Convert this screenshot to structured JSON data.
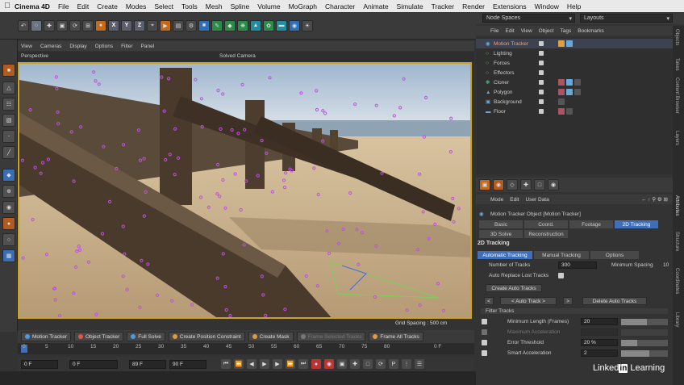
{
  "menubar": {
    "app": "Cinema 4D",
    "items": [
      "File",
      "Edit",
      "Create",
      "Modes",
      "Select",
      "Tools",
      "Mesh",
      "Spline",
      "Volume",
      "MoGraph",
      "Character",
      "Animate",
      "Simulate",
      "Tracker",
      "Render",
      "Extensions",
      "Window",
      "Help"
    ]
  },
  "toolbar": {
    "x_label": "X",
    "y_label": "Y",
    "z_label": "Z"
  },
  "viewport": {
    "menu": [
      "View",
      "Cameras",
      "Display",
      "Options",
      "Filter",
      "Panel"
    ],
    "mode": "Perspective",
    "camera": "Solved Camera",
    "grid_spacing": "Grid Spacing : 500 cm"
  },
  "tracker_bar": {
    "items": [
      {
        "label": "Motion Tracker",
        "color": "#4a9be0"
      },
      {
        "label": "Object Tracker",
        "color": "#e0573c"
      },
      {
        "label": "Full Solve",
        "color": "#4a9be0"
      },
      {
        "label": "Create Position Constraint",
        "color": "#e09a3c"
      },
      {
        "label": "Create Mask",
        "color": "#e09a3c"
      },
      {
        "label": "Frame Selected Tracks",
        "color": "#999999"
      },
      {
        "label": "Frame All Tracks",
        "color": "#e09a3c"
      }
    ]
  },
  "timeline": {
    "ticks": [
      "0",
      "5",
      "10",
      "15",
      "20",
      "25",
      "30",
      "35",
      "40",
      "45",
      "50",
      "55",
      "60",
      "65",
      "70",
      "75",
      "80"
    ],
    "end_label": "0 F"
  },
  "transport": {
    "f1": "0 F",
    "f2": "0 F",
    "f3": "89 F",
    "f4": "90 F"
  },
  "right_top": {
    "node_spaces": "Node Spaces",
    "layouts": "Layouts"
  },
  "object_manager": {
    "menu": [
      "File",
      "Edit",
      "View",
      "Object",
      "Tags",
      "Bookmarks"
    ],
    "objects": [
      {
        "name": "Motion Tracker",
        "highlight": true
      },
      {
        "name": "Lighting",
        "highlight": false
      },
      {
        "name": "Forces",
        "highlight": false
      },
      {
        "name": "Effectors",
        "highlight": false
      },
      {
        "name": "Cloner",
        "highlight": false
      },
      {
        "name": "Polygon",
        "highlight": false
      },
      {
        "name": "Background",
        "highlight": false
      },
      {
        "name": "Floor",
        "highlight": false
      }
    ]
  },
  "side_tabs": [
    "Objects",
    "Takes",
    "Content Browser",
    "Layers",
    "Attributes",
    "Structure",
    "Coordinates",
    "Library"
  ],
  "attributes": {
    "menu": [
      "Mode",
      "Edit",
      "User Data"
    ],
    "object_title": "Motion Tracker Object [Motion Tracker]",
    "tabs_row1": [
      "Basic",
      "Coord.",
      "Footage",
      "2D Tracking"
    ],
    "tabs_row2": [
      "3D Solve",
      "Reconstruction"
    ],
    "active_tab": "2D Tracking",
    "section": "2D Tracking",
    "subtabs": [
      "Automatic Tracking",
      "Manual Tracking",
      "Options"
    ],
    "number_of_tracks_label": "Number of Tracks",
    "number_of_tracks": "300",
    "minimum_spacing_label": "Minimum Spacing",
    "minimum_spacing": "10",
    "auto_replace_label": "Auto Replace Lost Tracks",
    "create_auto_tracks": "Create Auto Tracks",
    "auto_track_prev": "<",
    "auto_track_mid": "< Auto Track >",
    "auto_track_next": ">",
    "delete_auto_tracks": "Delete Auto Tracks",
    "filter_tracks": "Filter Tracks",
    "min_length_label": "Minimum Length (Frames)",
    "min_length": "20",
    "max_accel_label": "Maximum Acceleration",
    "error_threshold_label": "Error Threshold",
    "error_threshold": "20 %",
    "smart_accel_label": "Smart Acceleration",
    "smart_accel": "2",
    "min_length_fill": 0.55,
    "error_fill": 0.35,
    "smart_fill": 0.6
  },
  "watermark": {
    "linkedin": "Linked",
    "in": "in",
    "learning": "Learning"
  }
}
